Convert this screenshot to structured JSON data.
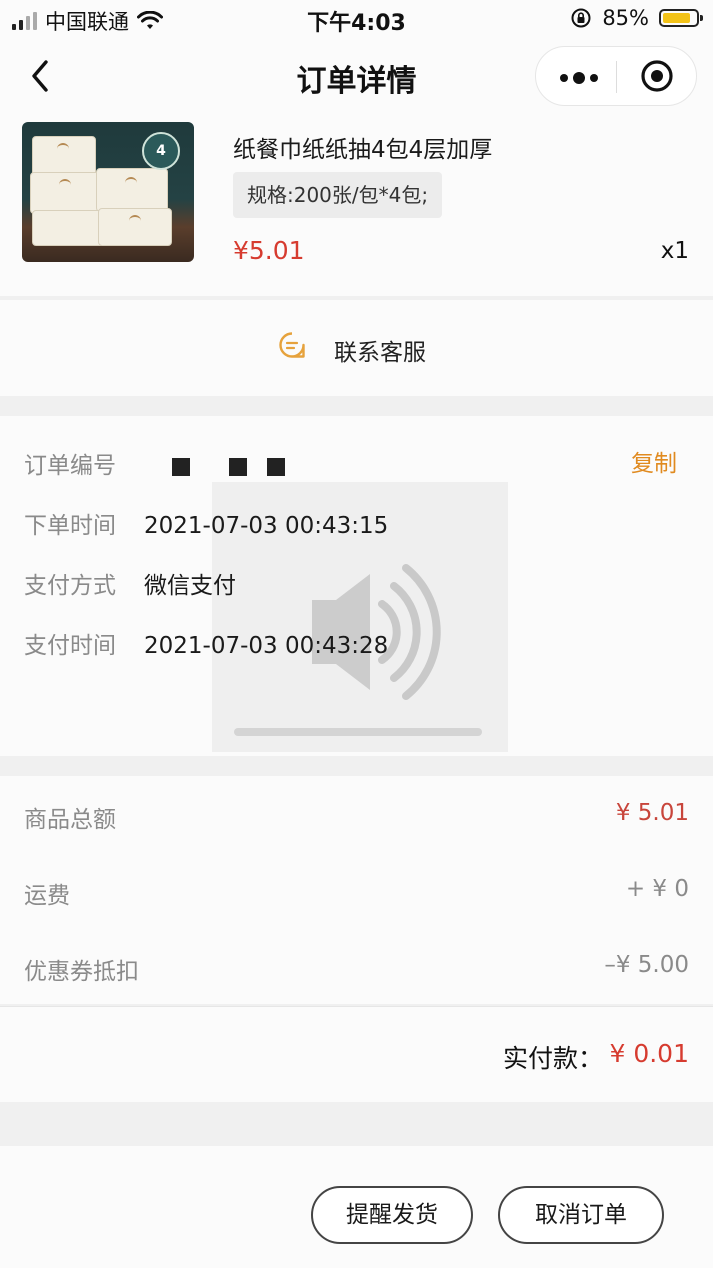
{
  "status_bar": {
    "carrier": "中国联通",
    "time": "下午4:03",
    "battery_percent": "85%",
    "battery_level": 0.85
  },
  "nav": {
    "title": "订单详情"
  },
  "product": {
    "name": "纸餐巾纸纸抽4包4层加厚",
    "spec": "规格:200张/包*4包;",
    "price": "¥5.01",
    "quantity": "x1",
    "image_badge": "4"
  },
  "contact": {
    "label": "联系客服"
  },
  "order_info": {
    "order_number_label": "订单编号",
    "copy_label": "复制",
    "order_time_label": "下单时间",
    "order_time": "2021-07-03 00:43:15",
    "pay_method_label": "支付方式",
    "pay_method": "微信支付",
    "pay_time_label": "支付时间",
    "pay_time": "2021-07-03 00:43:28"
  },
  "amounts": {
    "goods_total_label": "商品总额",
    "goods_total": "¥ 5.01",
    "shipping_label": "运费",
    "shipping": "+ ¥ 0",
    "coupon_label": "优惠券抵扣",
    "coupon": "–¥ 5.00",
    "paid_label": "实付款：",
    "paid": "¥ 0.01"
  },
  "actions": {
    "remind_label": "提醒发货",
    "cancel_label": "取消订单"
  },
  "colors": {
    "price_red": "#d63b2f",
    "copy_orange": "#e08a1f",
    "battery_yellow": "#f3c318"
  }
}
